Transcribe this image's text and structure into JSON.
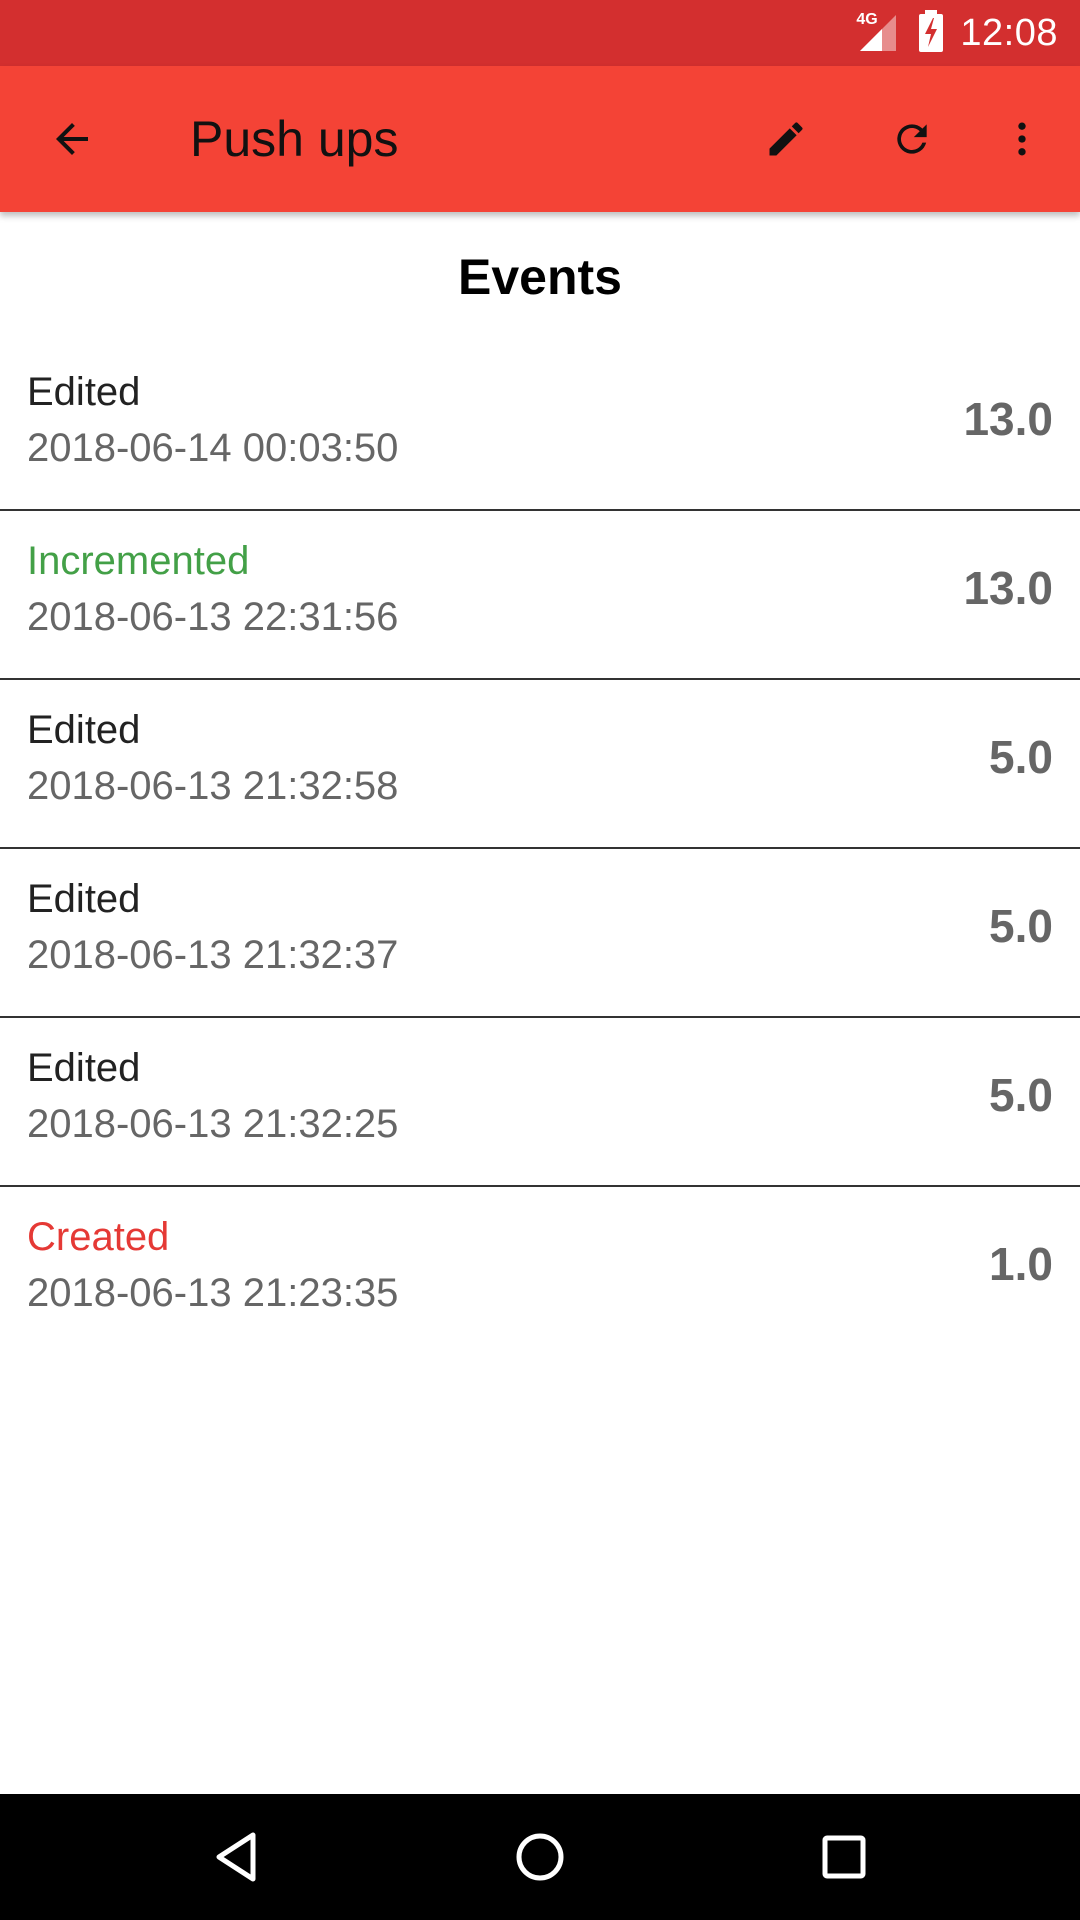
{
  "status_bar": {
    "network_type": "4G",
    "time": "12:08",
    "colors": {
      "background": "#d32f2f"
    }
  },
  "app_bar": {
    "title": "Push ups",
    "icons": {
      "back": "arrow-back-icon",
      "edit": "pencil-icon",
      "reset": "refresh-icon",
      "more": "more-vert-icon"
    },
    "colors": {
      "background": "#f44336"
    }
  },
  "main": {
    "section_title": "Events",
    "events": [
      {
        "type": "Edited",
        "timestamp": "2018-06-14 00:03:50",
        "value": "13.0",
        "type_color": "#222222"
      },
      {
        "type": "Incremented",
        "timestamp": "2018-06-13 22:31:56",
        "value": "13.0",
        "type_color": "#43a047"
      },
      {
        "type": "Edited",
        "timestamp": "2018-06-13 21:32:58",
        "value": "5.0",
        "type_color": "#222222"
      },
      {
        "type": "Edited",
        "timestamp": "2018-06-13 21:32:37",
        "value": "5.0",
        "type_color": "#222222"
      },
      {
        "type": "Edited",
        "timestamp": "2018-06-13 21:32:25",
        "value": "5.0",
        "type_color": "#222222"
      },
      {
        "type": "Created",
        "timestamp": "2018-06-13 21:23:35",
        "value": "1.0",
        "type_color": "#e53935"
      }
    ]
  },
  "nav_bar": {
    "icons": {
      "back": "triangle-back-icon",
      "home": "circle-home-icon",
      "recents": "square-recents-icon"
    }
  }
}
